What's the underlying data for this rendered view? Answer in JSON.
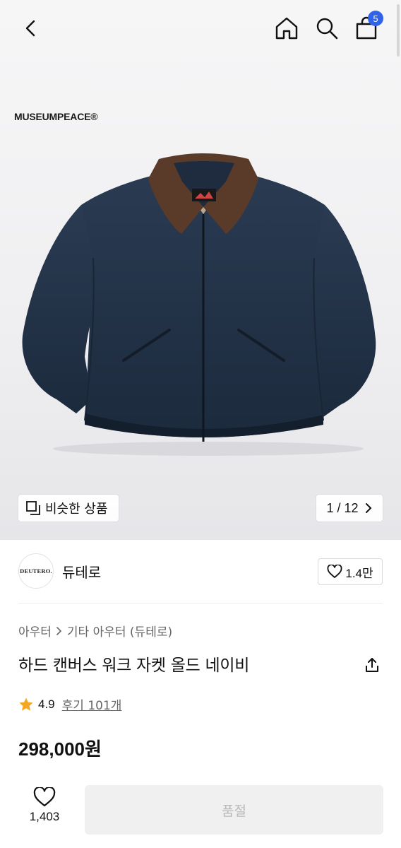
{
  "header": {
    "cart_count": "5"
  },
  "gallery": {
    "brand_logo_text": "MUSEUMPEACE®",
    "similar_label": "비슷한 상품",
    "pager_text": "1 / 12",
    "jacket_label_text": "MUSEUMPEACE"
  },
  "store": {
    "avatar_text": "DEUTERO.",
    "avatar_subtext": "",
    "name": "듀테로",
    "like_count": "1.4만"
  },
  "product": {
    "breadcrumb": [
      "아우터",
      "기타 아우터 (듀테로)"
    ],
    "title": "하드 캔버스 워크 자켓 올드 네이비",
    "rating": "4.9",
    "reviews": "후기 101개",
    "price": "298,000원"
  },
  "footer": {
    "like_count": "1,403",
    "soldout_label": "품절"
  },
  "colors": {
    "accent": "#2f63e9",
    "star": "#f5a623",
    "jacket_body": "#24344a",
    "jacket_collar": "#5a3b2a"
  },
  "icons": [
    "back-icon",
    "home-icon",
    "search-icon",
    "shopping-bag-icon",
    "similar-items-icon",
    "chevron-right-icon",
    "heart-icon",
    "share-icon",
    "star-icon"
  ]
}
